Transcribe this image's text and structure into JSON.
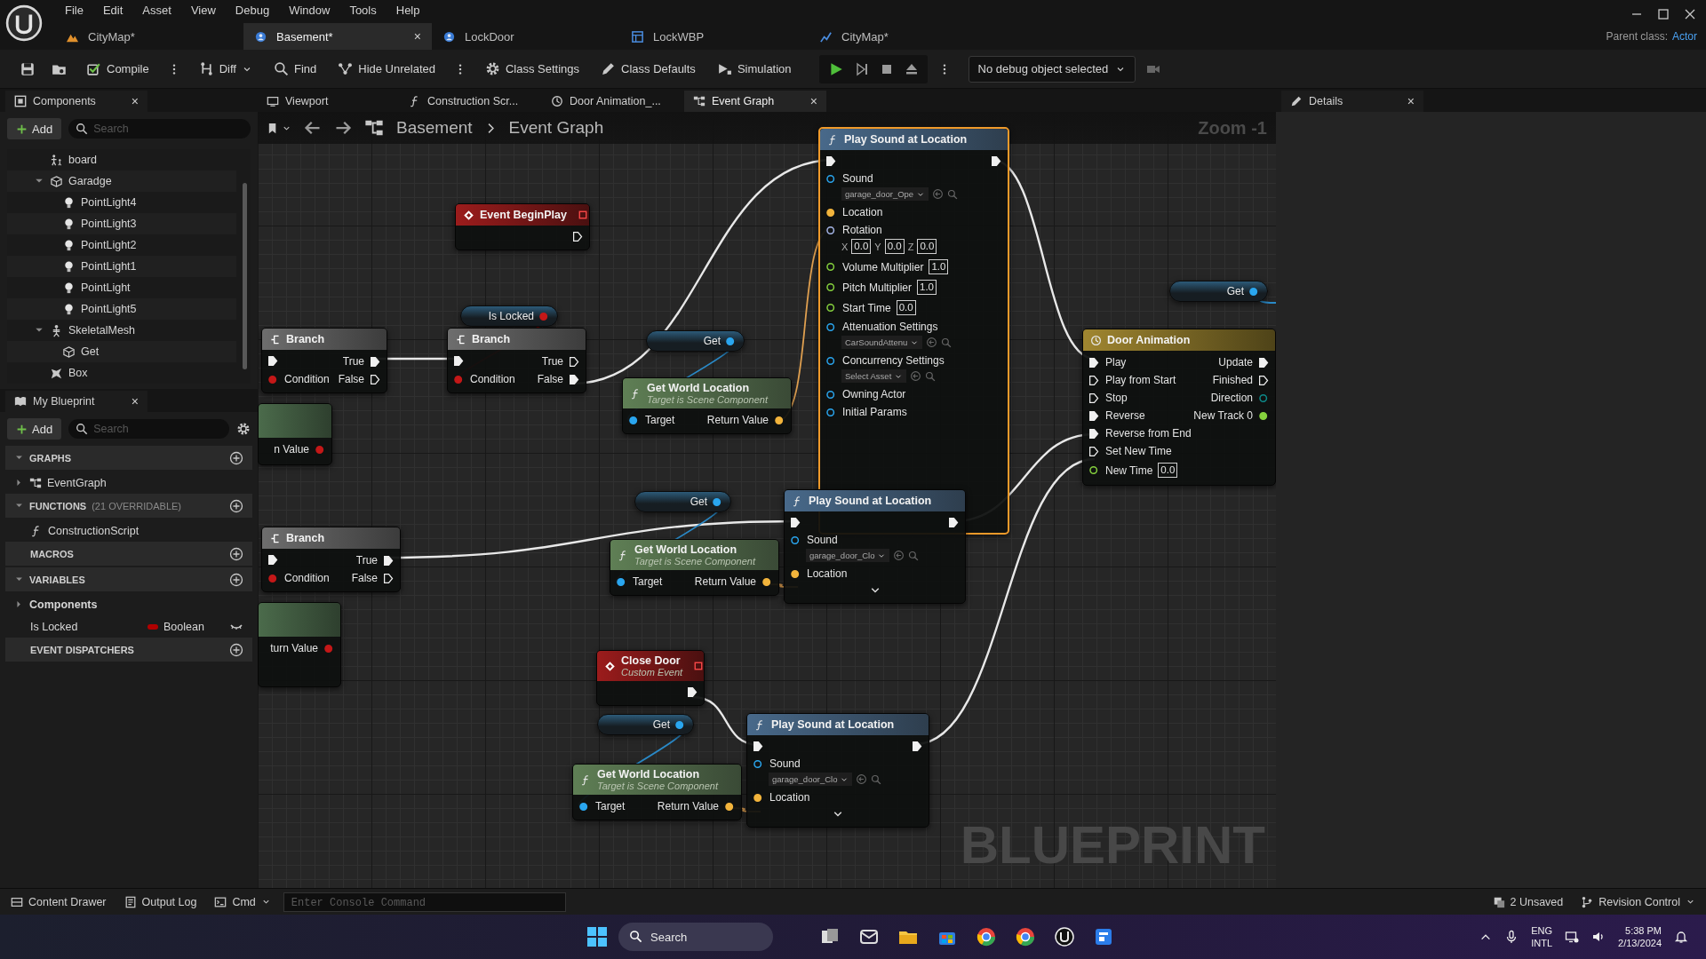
{
  "title_bar": {
    "menu": [
      "File",
      "Edit",
      "Asset",
      "View",
      "Debug",
      "Window",
      "Tools",
      "Help"
    ],
    "parent_class_label": "Parent class:",
    "parent_class": "Actor"
  },
  "doc_tabs": [
    {
      "label": "CityMap*",
      "selected": false
    },
    {
      "label": "Basement*",
      "selected": true,
      "close": "×"
    },
    {
      "label": "LockDoor",
      "selected": false
    },
    {
      "label": "LockWBP",
      "selected": false
    },
    {
      "label": "CityMap*",
      "selected": false
    }
  ],
  "toolbar": {
    "buttons": [
      {
        "label": "Compile"
      },
      {
        "label": "Diff"
      },
      {
        "label": "Find"
      },
      {
        "label": "Hide Unrelated"
      },
      {
        "label": "Class Settings"
      },
      {
        "label": "Class Defaults"
      },
      {
        "label": "Simulation"
      }
    ],
    "debug_object": "No debug object selected"
  },
  "components_panel": {
    "tab": "Components",
    "close": "×",
    "add": "Add",
    "search_placeholder": "Search",
    "tree": [
      {
        "kind": "actor",
        "label": "board"
      },
      {
        "kind": "mesh",
        "label": "Garadge",
        "expanded": true,
        "children": [
          {
            "kind": "light",
            "label": "PointLight4"
          },
          {
            "kind": "light",
            "label": "PointLight3"
          },
          {
            "kind": "light",
            "label": "PointLight2"
          },
          {
            "kind": "light",
            "label": "PointLight1"
          },
          {
            "kind": "light",
            "label": "PointLight"
          },
          {
            "kind": "light",
            "label": "PointLight5"
          }
        ]
      },
      {
        "kind": "skeleton",
        "label": "SkeletalMesh",
        "expanded": true,
        "children": [
          {
            "kind": "mesh",
            "label": "Get"
          }
        ]
      },
      {
        "kind": "box",
        "label": "Box"
      }
    ]
  },
  "my_blueprint": {
    "tab": "My Blueprint",
    "close": "×",
    "add": "Add",
    "search_placeholder": "Search",
    "sections": [
      {
        "title": "GRAPHS",
        "expanded": true,
        "items": [
          {
            "kind": "graph",
            "label": "EventGraph",
            "expanded": false
          }
        ]
      },
      {
        "title": "FUNCTIONS",
        "note": "(21 OVERRIDABLE)",
        "expanded": true,
        "items": [
          {
            "kind": "function",
            "label": "ConstructionScript"
          }
        ]
      },
      {
        "title": "MACROS"
      },
      {
        "title": "VARIABLES",
        "expanded": true,
        "items": [
          {
            "kind": "category",
            "label": "Components",
            "expanded": false
          },
          {
            "kind": "variable",
            "label": "Is Locked",
            "type": "Boolean",
            "color": "#b00000"
          }
        ]
      },
      {
        "title": "EVENT DISPATCHERS"
      }
    ]
  },
  "graph_tabs": [
    {
      "label": "Viewport",
      "selected": false
    },
    {
      "label": "Construction Scr...",
      "selected": false
    },
    {
      "label": "Door Animation_...",
      "selected": false
    },
    {
      "label": "Event Graph",
      "selected": true,
      "close": "×"
    }
  ],
  "details": {
    "tab": "Details",
    "close": "×"
  },
  "graph": {
    "breadcrumb": [
      "Basement",
      "Event Graph"
    ],
    "zoom": "Zoom -1",
    "watermark": "BLUEPRINT",
    "nodes": [
      {
        "kind": "function",
        "title": "Play Sound at Location",
        "selected": true,
        "rows": [
          {
            "in": {
              "kind": "exec",
              "connected": true
            },
            "out": {
              "kind": "exec",
              "connected": true
            }
          },
          {
            "in": {
              "kind": "object",
              "label": "Sound",
              "connected": false,
              "asset": "garage_door_Ope"
            }
          },
          {
            "in": {
              "kind": "vector",
              "label": "Location",
              "connected": true
            }
          },
          {
            "in": {
              "kind": "rotator",
              "label": "Rotation",
              "connected": false,
              "xyz": [
                {
                  "axis": "X",
                  "value": "0.0"
                },
                {
                  "axis": "Y",
                  "value": "0.0"
                },
                {
                  "axis": "Z",
                  "value": "0.0"
                }
              ]
            }
          },
          {
            "in": {
              "kind": "float",
              "label": "Volume Multiplier",
              "connected": false,
              "value": "1.0"
            }
          },
          {
            "in": {
              "kind": "float",
              "label": "Pitch Multiplier",
              "connected": false,
              "value": "1.0"
            }
          },
          {
            "in": {
              "kind": "float",
              "label": "Start Time",
              "connected": false,
              "value": "0.0"
            }
          },
          {
            "in": {
              "kind": "object",
              "label": "Attenuation Settings",
              "connected": false,
              "asset": "CarSoundAttenu"
            }
          },
          {
            "in": {
              "kind": "object",
              "label": "Concurrency Settings",
              "connected": false,
              "asset": "Select Asset"
            }
          },
          {
            "in": {
              "kind": "object",
              "label": "Owning Actor",
              "connected": false
            }
          },
          {
            "in": {
              "kind": "object",
              "label": "Initial Params",
              "connected": false
            }
          }
        ]
      },
      {
        "kind": "event",
        "title": "Event BeginPlay",
        "selected": false,
        "rows": [
          {
            "out": {
              "kind": "exec",
              "connected": false
            }
          }
        ]
      },
      {
        "kind": "variable_get",
        "title": "Is Locked",
        "selected": false,
        "rows": [
          {
            "out": {
              "kind": "bool",
              "connected": true
            }
          }
        ]
      },
      {
        "kind": "branch",
        "title": "Branch",
        "selected": false,
        "rows": [
          {
            "in": {
              "kind": "exec",
              "connected": true
            },
            "out": {
              "kind": "exec",
              "label": "True",
              "connected": true
            }
          },
          {
            "in": {
              "kind": "bool",
              "label": "Condition",
              "connected": true
            },
            "out": {
              "kind": "exec",
              "label": "False",
              "connected": false
            }
          }
        ]
      },
      {
        "kind": "branch",
        "title": "Branch",
        "selected": false,
        "rows": [
          {
            "in": {
              "kind": "exec",
              "connected": true
            },
            "out": {
              "kind": "exec",
              "label": "True",
              "connected": false
            }
          },
          {
            "in": {
              "kind": "bool",
              "label": "Condition",
              "connected": true
            },
            "out": {
              "kind": "exec",
              "label": "False",
              "connected": true
            }
          }
        ]
      },
      {
        "kind": "variable_get",
        "title": "Get",
        "selected": false,
        "rows": [
          {
            "out": {
              "kind": "object",
              "connected": true
            }
          }
        ]
      },
      {
        "kind": "pure_function",
        "title": "Get World Location",
        "subtitle": "Target is Scene Component",
        "selected": false,
        "rows": [
          {
            "in": {
              "kind": "object",
              "label": "Target",
              "connected": true
            },
            "out": {
              "kind": "vector",
              "label": "Return Value",
              "connected": true
            }
          }
        ]
      },
      {
        "kind": "pure_cut",
        "selected": false,
        "rows": [
          {
            "out": {
              "kind": "bool",
              "label": "n Value",
              "connected": true
            }
          }
        ]
      },
      {
        "kind": "variable_get",
        "title": "Get",
        "selected": false,
        "rows": [
          {
            "out": {
              "kind": "object",
              "connected": true
            }
          }
        ]
      },
      {
        "kind": "function",
        "title": "Play Sound at Location",
        "selected": false,
        "advanced_expanded": false,
        "rows": [
          {
            "in": {
              "kind": "exec",
              "connected": true
            },
            "out": {
              "kind": "exec",
              "connected": true
            }
          },
          {
            "in": {
              "kind": "object",
              "label": "Sound",
              "connected": false,
              "asset": "garage_door_Clo"
            }
          },
          {
            "in": {
              "kind": "vector",
              "label": "Location",
              "connected": true
            }
          }
        ]
      },
      {
        "kind": "branch",
        "title": "Branch",
        "selected": false,
        "rows": [
          {
            "in": {
              "kind": "exec",
              "connected": true
            },
            "out": {
              "kind": "exec",
              "label": "True",
              "connected": true
            }
          },
          {
            "in": {
              "kind": "bool",
              "label": "Condition",
              "connected": true
            },
            "out": {
              "kind": "exec",
              "label": "False",
              "connected": false
            }
          }
        ]
      },
      {
        "kind": "pure_function",
        "title": "Get World Location",
        "subtitle": "Target is Scene Component",
        "selected": false,
        "rows": [
          {
            "in": {
              "kind": "object",
              "label": "Target",
              "connected": true
            },
            "out": {
              "kind": "vector",
              "label": "Return Value",
              "connected": true
            }
          }
        ]
      },
      {
        "kind": "pure_cut",
        "selected": false,
        "rows": [
          {
            "out": {
              "kind": "bool",
              "label": "turn Value",
              "connected": true
            }
          }
        ]
      },
      {
        "kind": "event",
        "title": "Close Door",
        "subtitle": "Custom Event",
        "selected": false,
        "rows": [
          {
            "out": {
              "kind": "exec",
              "connected": true
            }
          }
        ]
      },
      {
        "kind": "variable_get",
        "title": "Get",
        "selected": false,
        "rows": [
          {
            "out": {
              "kind": "object",
              "connected": true
            }
          }
        ]
      },
      {
        "kind": "pure_function",
        "title": "Get World Location",
        "subtitle": "Target is Scene Component",
        "selected": false,
        "rows": [
          {
            "in": {
              "kind": "object",
              "label": "Target",
              "connected": true
            },
            "out": {
              "kind": "vector",
              "label": "Return Value",
              "connected": true
            }
          }
        ]
      },
      {
        "kind": "function",
        "title": "Play Sound at Location",
        "selected": false,
        "advanced_expanded": false,
        "rows": [
          {
            "in": {
              "kind": "exec",
              "connected": true
            },
            "out": {
              "kind": "exec",
              "connected": true
            }
          },
          {
            "in": {
              "kind": "object",
              "label": "Sound",
              "connected": false,
              "asset": "garage_door_Clo"
            }
          },
          {
            "in": {
              "kind": "vector",
              "label": "Location",
              "connected": true
            }
          }
        ]
      },
      {
        "kind": "variable_get",
        "title": "Get",
        "selected": false,
        "rows": [
          {
            "out": {
              "kind": "object",
              "connected": true
            }
          }
        ]
      },
      {
        "kind": "timeline",
        "title": "Door Animation",
        "selected": false,
        "rows": [
          {
            "in": {
              "kind": "exec",
              "label": "Play",
              "connected": true
            },
            "out": {
              "kind": "exec",
              "label": "Update",
              "connected": true
            }
          },
          {
            "in": {
              "kind": "exec",
              "label": "Play from Start",
              "connected": false
            },
            "out": {
              "kind": "exec",
              "label": "Finished",
              "connected": false
            }
          },
          {
            "in": {
              "kind": "exec",
              "label": "Stop",
              "connected": false
            },
            "out": {
              "kind": "enum",
              "label": "Direction",
              "connected": false
            }
          },
          {
            "in": {
              "kind": "exec",
              "label": "Reverse",
              "connected": true
            },
            "out": {
              "kind": "float",
              "label": "New Track 0",
              "connected": true
            }
          },
          {
            "in": {
              "kind": "exec",
              "label": "Reverse from End",
              "connected": true
            }
          },
          {
            "in": {
              "kind": "exec",
              "label": "Set New Time",
              "connected": false
            }
          },
          {
            "in": {
              "kind": "float",
              "label": "New Time",
              "connected": false,
              "value": "0.0"
            }
          }
        ]
      }
    ]
  },
  "status_bar": {
    "items": [
      "Content Drawer",
      "Output Log"
    ],
    "cmd": "Cmd",
    "console_placeholder": "Enter Console Command",
    "unsaved": "2 Unsaved",
    "revision_control": "Revision Control"
  },
  "taskbar": {
    "search_placeholder": "Search",
    "language": "ENG",
    "layout": "INTL",
    "time": "5:38 PM",
    "date": "2/13/2024"
  }
}
